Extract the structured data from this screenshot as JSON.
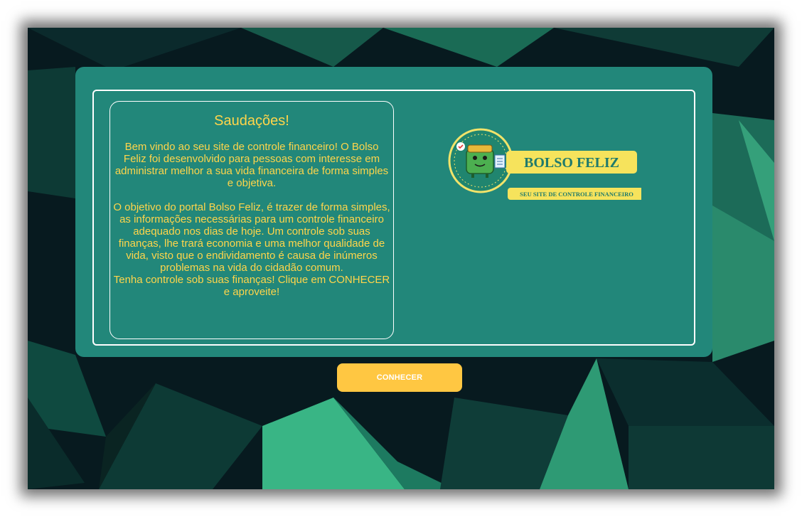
{
  "welcome": {
    "title": "Saudações!",
    "paragraph1": "Bem vindo ao seu site de controle financeiro! O Bolso Feliz foi desenvolvido para pessoas com interesse em administrar melhor a sua vida financeira de forma simples e objetiva.",
    "paragraph2": "O objetivo do portal Bolso Feliz, é trazer de forma simples, as informações necessárias para um controle financeiro adequado nos dias de hoje. Um controle sob suas finanças, lhe trará economia e uma melhor qualidade de vida, visto que o endividamento é causa de inúmeros problemas na vida do cidadão comum.",
    "paragraph3": "Tenha controle sob suas finanças! Clique em CONHECER e aproveite!"
  },
  "logo": {
    "name": "BOLSO FELIZ",
    "tagline": "SEU SITE DE CONTROLE FINANCEIRO",
    "icon": "green-wallet-mascot-icon"
  },
  "cta": {
    "label": "CONHECER"
  },
  "colors": {
    "card": "#22877a",
    "accent": "#ffd54a",
    "button": "#ffc742",
    "background": "#071a1f"
  }
}
